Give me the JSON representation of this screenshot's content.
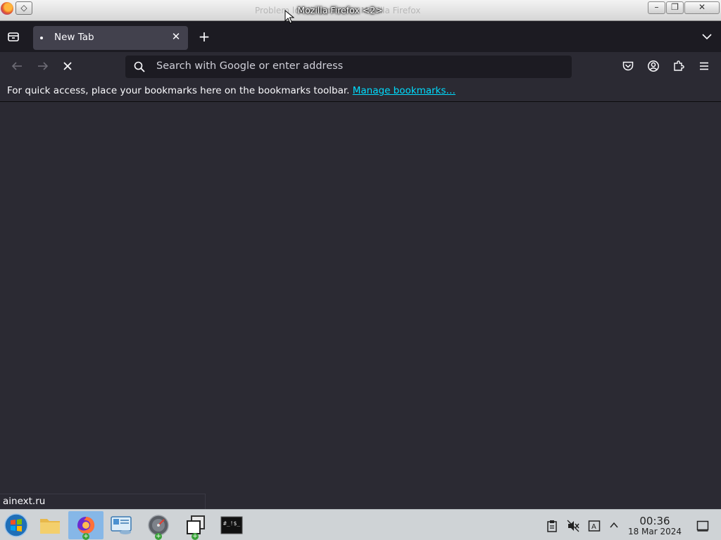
{
  "window": {
    "title": "Mozilla Firefox <2>",
    "ghost_title": "Problem loading page — Mozilla Firefox",
    "minimize": "–",
    "restore": "❐",
    "close": "✕",
    "pin": "◇"
  },
  "tabs": [
    {
      "label": "New Tab",
      "close": "✕",
      "icon": "loading-dot-icon"
    }
  ],
  "tabstrip": {
    "new_tab": "+",
    "list_all": "⌄"
  },
  "navbar": {
    "back": "←",
    "forward": "→",
    "stop": "✕",
    "url_placeholder": "Search with Google or enter address",
    "url_value": ""
  },
  "bookmarks_bar": {
    "message": "For quick access, place your bookmarks here on the bookmarks toolbar.",
    "link": "Manage bookmarks…"
  },
  "status_bar": {
    "text": "ainext.ru"
  },
  "taskbar": {
    "apps": [
      "start-menu-icon",
      "file-manager-icon",
      "firefox-icon",
      "remote-desktop-icon",
      "disk-utility-icon",
      "task-switcher-icon",
      "terminal-icon"
    ],
    "clock": {
      "time": "00:36",
      "date": "18 Mar 2024"
    }
  },
  "colors": {
    "chrome_dark": "#1c1b22",
    "toolbar": "#2b2a33",
    "link": "#00ddff",
    "taskbar": "#cfd3d6",
    "active_task": "#86b7e7"
  }
}
